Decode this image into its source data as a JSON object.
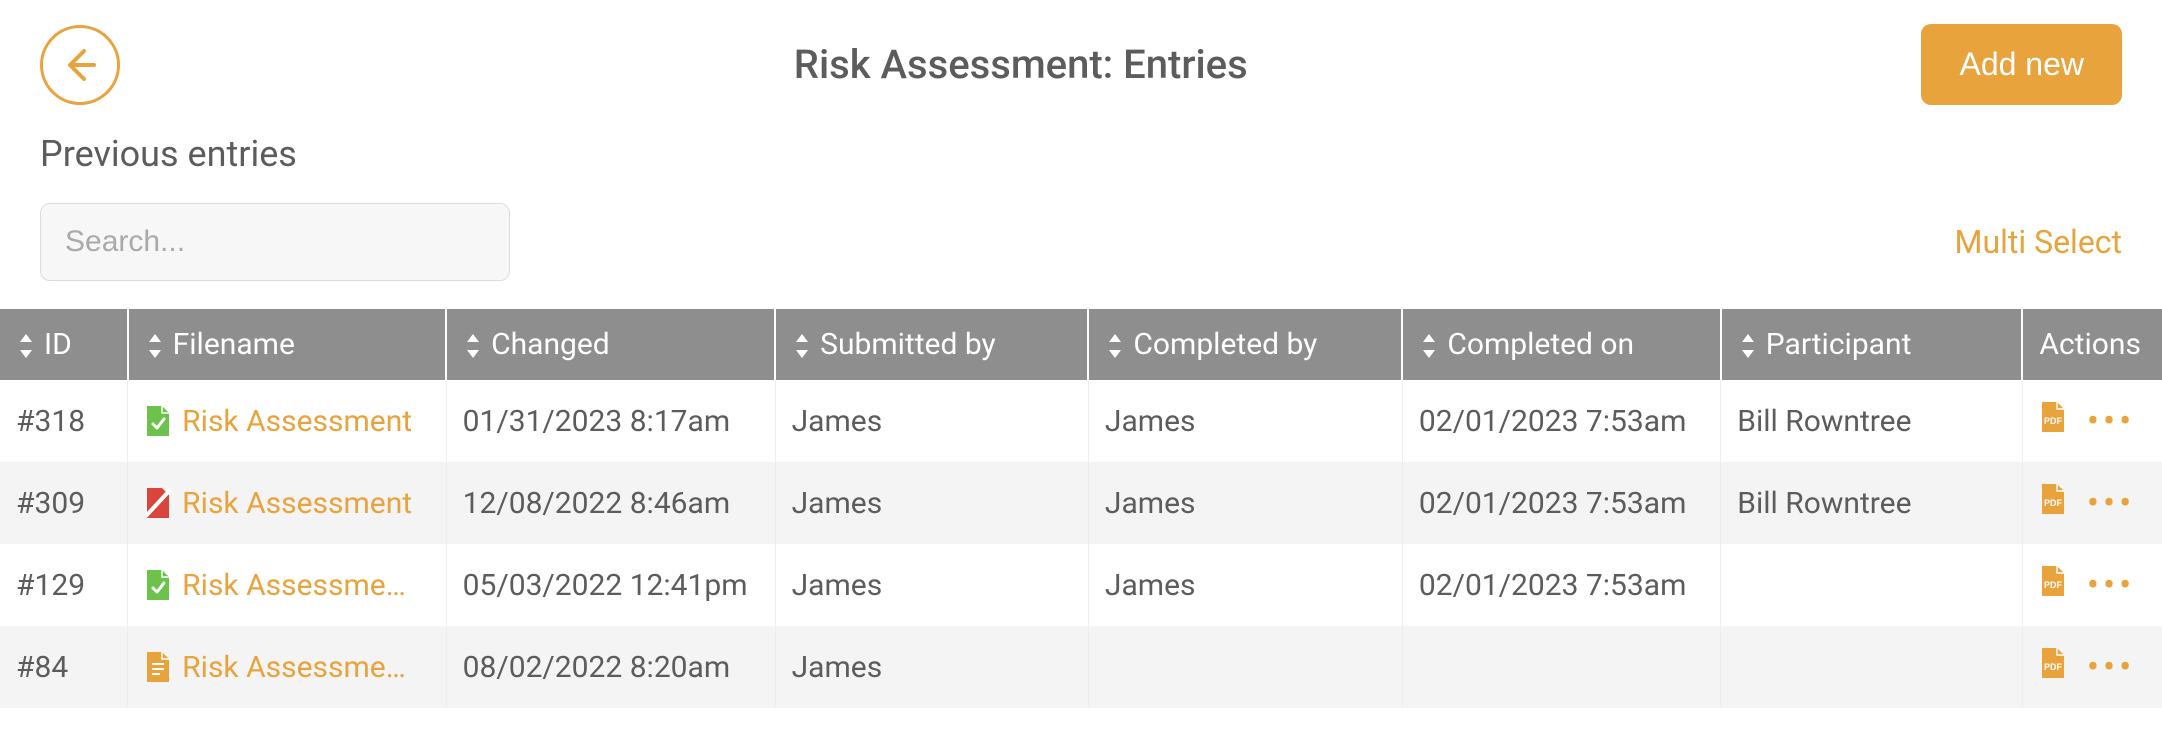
{
  "header": {
    "title": "Risk Assessment: Entries",
    "add_new_label": "Add new"
  },
  "subheader": "Previous entries",
  "search": {
    "placeholder": "Search...",
    "value": ""
  },
  "multi_select_label": "Multi Select",
  "columns": {
    "id": "ID",
    "filename": "Filename",
    "changed": "Changed",
    "submitted_by": "Submitted by",
    "completed_by": "Completed by",
    "completed_on": "Completed on",
    "participant": "Participant",
    "actions": "Actions"
  },
  "rows": [
    {
      "id": "#318",
      "filename": "Risk Assessment",
      "file_icon": "green-check",
      "changed": "01/31/2023 8:17am",
      "submitted_by": "James",
      "completed_by": "James",
      "completed_on": "02/01/2023 7:53am",
      "participant": "Bill Rowntree"
    },
    {
      "id": "#309",
      "filename": "Risk Assessment",
      "file_icon": "red-alert",
      "changed": "12/08/2022 8:46am",
      "submitted_by": "James",
      "completed_by": "James",
      "completed_on": "02/01/2023 7:53am",
      "participant": "Bill Rowntree"
    },
    {
      "id": "#129",
      "filename": "Risk Assessme…",
      "file_icon": "green-check",
      "changed": "05/03/2022 12:41pm",
      "submitted_by": "James",
      "completed_by": "James",
      "completed_on": "02/01/2023 7:53am",
      "participant": ""
    },
    {
      "id": "#84",
      "filename": "Risk Assessme…",
      "file_icon": "orange-doc",
      "changed": "08/02/2022 8:20am",
      "submitted_by": "James",
      "completed_by": "",
      "completed_on": "",
      "participant": ""
    }
  ],
  "colors": {
    "accent": "#e8a33d",
    "green": "#6cc24a",
    "red": "#d9453a"
  }
}
